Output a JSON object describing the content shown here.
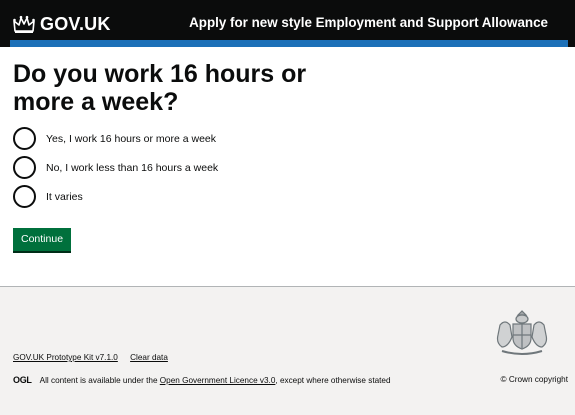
{
  "header": {
    "logo_text": "GOV.UK",
    "logo_icon": "crown-icon",
    "service_name": "Apply for new style Employment and Support Allowance"
  },
  "main": {
    "heading": "Do you work 16 hours or more a week?",
    "options": [
      "Yes, I work 16 hours or more a week",
      "No, I work less than 16 hours a week",
      "It varies"
    ],
    "continue_label": "Continue"
  },
  "footer": {
    "links": [
      "GOV.UK Prototype Kit v7.1.0",
      "Clear data"
    ],
    "ogl_logo_text": "OGL",
    "licence_prefix": "All content is available under the ",
    "licence_link": "Open Government Licence v3.0",
    "licence_suffix": ", except where otherwise stated",
    "copyright": "© Crown copyright",
    "crest_icon": "royal-coat-of-arms-icon"
  },
  "colors": {
    "header_bg": "#0b0c0c",
    "header_stripe": "#1d70b8",
    "button_green": "#00703c",
    "footer_bg": "#f3f2f1"
  }
}
